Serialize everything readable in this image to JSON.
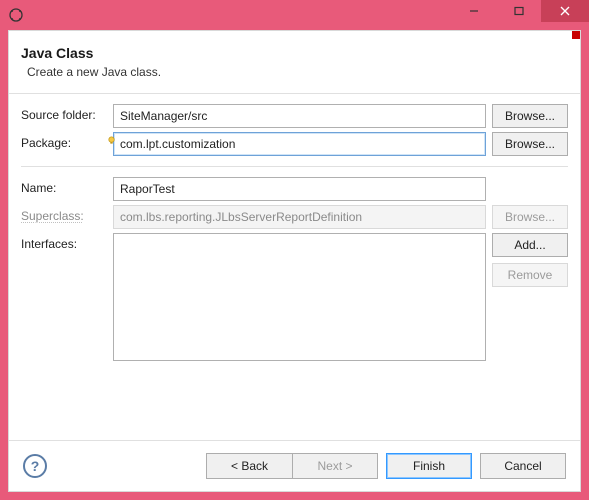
{
  "window": {
    "title": "",
    "controls": {
      "minimize": "minimize",
      "maximize": "maximize",
      "close": "close"
    }
  },
  "banner": {
    "heading": "Java Class",
    "subheading": "Create a new Java class."
  },
  "form": {
    "sourceFolder": {
      "label": "Source folder:",
      "value": "SiteManager/src",
      "browse": "Browse..."
    },
    "package": {
      "label": "Package:",
      "value": "com.lpt.customization",
      "browse": "Browse..."
    },
    "name": {
      "label": "Name:",
      "value": "RaporTest"
    },
    "superclass": {
      "label": "Superclass:",
      "value": "com.lbs.reporting.JLbsServerReportDefinition",
      "browse": "Browse..."
    },
    "interfaces": {
      "label": "Interfaces:",
      "add": "Add...",
      "remove": "Remove"
    }
  },
  "footer": {
    "back": "< Back",
    "next": "Next >",
    "finish": "Finish",
    "cancel": "Cancel"
  }
}
